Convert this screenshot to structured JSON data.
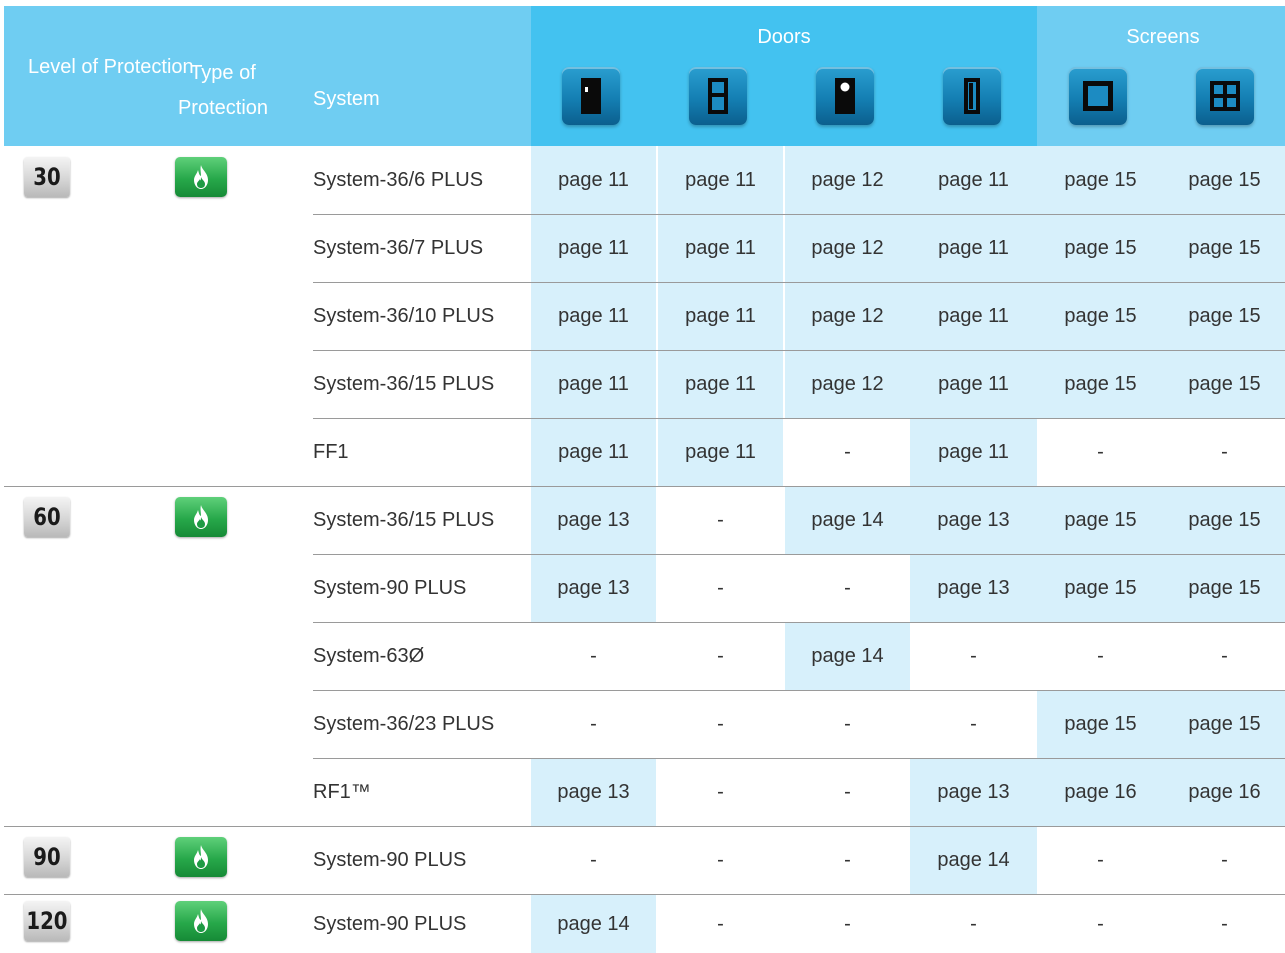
{
  "header": {
    "level": "Level of Protection",
    "type": "Type of Protection",
    "system": "System",
    "doors": "Doors",
    "screens": "Screens"
  },
  "icons": [
    "door-solid-icon",
    "door-glazed-panels-icon",
    "door-porthole-icon",
    "door-narrow-icon",
    "screen-frame-icon",
    "screen-window-icon"
  ],
  "colors": {
    "header": "#6fcdf2",
    "doors_header": "#43c2f0",
    "highlight": "#d7f0fb",
    "fire_badge": "#27a84a"
  },
  "groups": [
    {
      "level": "30",
      "type_icon": "fire-icon"
    },
    {
      "level": "60",
      "type_icon": "fire-icon"
    },
    {
      "level": "90",
      "type_icon": "fire-icon"
    },
    {
      "level": "120",
      "type_icon": "fire-icon"
    }
  ],
  "rows": [
    {
      "system": "System-36/6 PLUS",
      "cells": [
        "page 11",
        "page 11",
        "page 12",
        "page 11",
        "page 15",
        "page 15"
      ]
    },
    {
      "system": "System-36/7 PLUS",
      "cells": [
        "page 11",
        "page 11",
        "page 12",
        "page 11",
        "page 15",
        "page 15"
      ]
    },
    {
      "system": "System-36/10 PLUS",
      "cells": [
        "page 11",
        "page 11",
        "page 12",
        "page 11",
        "page 15",
        "page 15"
      ]
    },
    {
      "system": "System-36/15 PLUS",
      "cells": [
        "page 11",
        "page 11",
        "page 12",
        "page 11",
        "page 15",
        "page 15"
      ]
    },
    {
      "system": "FF1",
      "cells": [
        "page 11",
        "page 11",
        "-",
        "page 11",
        "-",
        "-"
      ]
    },
    {
      "system": "System-36/15 PLUS",
      "cells": [
        "page 13",
        "-",
        "page 14",
        "page 13",
        "page 15",
        "page 15"
      ]
    },
    {
      "system": "System-90 PLUS",
      "cells": [
        "page 13",
        "-",
        "-",
        "page 13",
        "page 15",
        "page 15"
      ]
    },
    {
      "system": "System-63Ø",
      "cells": [
        "-",
        "-",
        "page 14",
        "-",
        "-",
        "-"
      ]
    },
    {
      "system": "System-36/23 PLUS",
      "cells": [
        "-",
        "-",
        "-",
        "-",
        "page 15",
        "page 15"
      ]
    },
    {
      "system": "RF1™",
      "cells": [
        "page 13",
        "-",
        "-",
        "page 13",
        "page 16",
        "page 16"
      ]
    },
    {
      "system": "System-90 PLUS",
      "cells": [
        "-",
        "-",
        "-",
        "page 14",
        "-",
        "-"
      ]
    },
    {
      "system": "System-90 PLUS",
      "cells": [
        "page 14",
        "-",
        "-",
        "-",
        "-",
        "-"
      ]
    }
  ]
}
